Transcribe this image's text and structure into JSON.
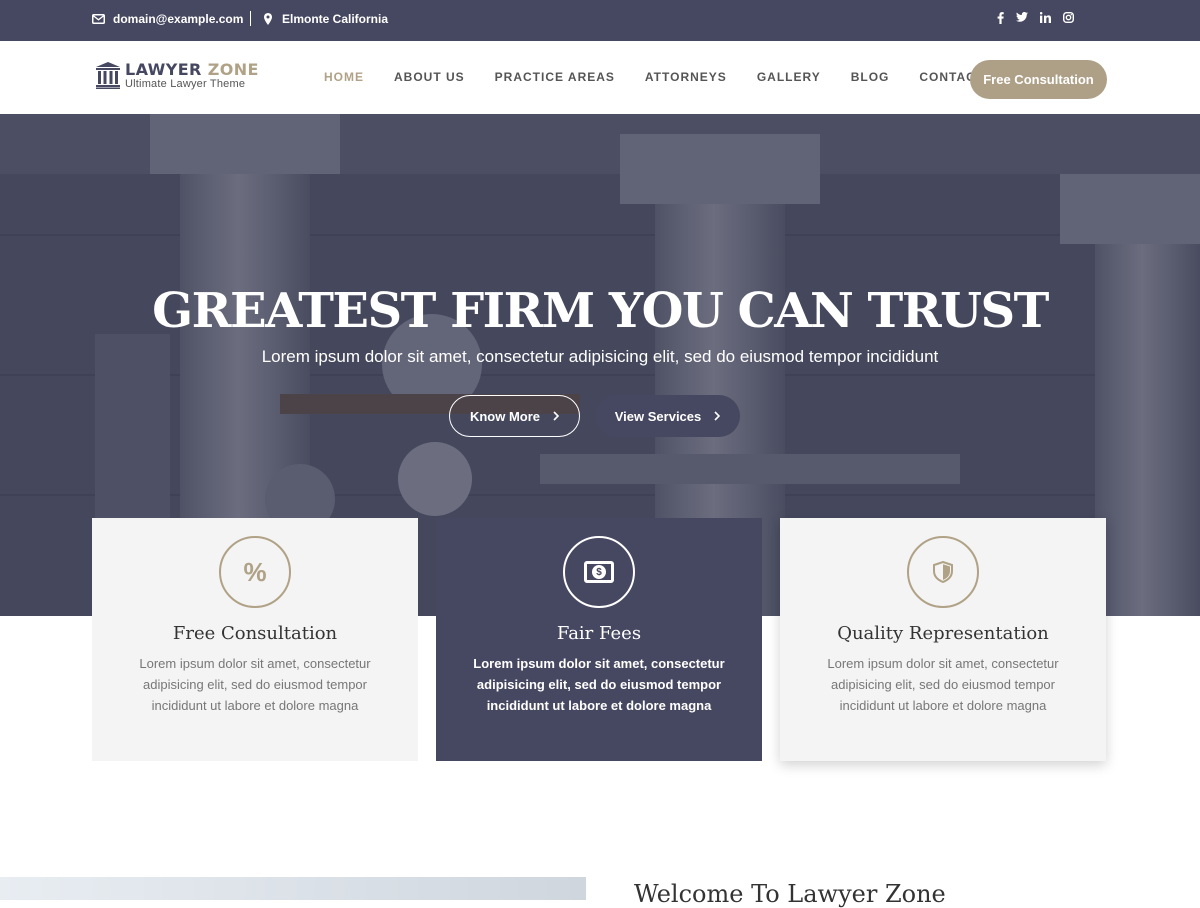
{
  "topbar": {
    "email": "domain@example.com",
    "location": "Elmonte California"
  },
  "social": {
    "facebook": "f",
    "twitter": "t",
    "linkedin": "in",
    "instagram": "ig"
  },
  "logo": {
    "title_part1": "LAWYER ",
    "title_part2": "ZONE",
    "subtitle": "Ultimate Lawyer Theme"
  },
  "nav": {
    "items": [
      "HOME",
      "ABOUT US",
      "PRACTICE AREAS",
      "ATTORNEYS",
      "GALLERY",
      "BLOG",
      "CONTACT"
    ]
  },
  "cta": {
    "label": "Free Consultation"
  },
  "hero": {
    "title": "GREATEST FIRM YOU CAN TRUST",
    "subtitle": "Lorem ipsum dolor sit amet, consectetur adipisicing elit, sed do eiusmod tempor incididunt",
    "btn_know": "Know More",
    "btn_view": "View Services"
  },
  "cards": [
    {
      "title": "Free Consultation",
      "text": "Lorem ipsum dolor sit amet, consectetur adipisicing elit, sed do eiusmod tempor incididunt ut labore et dolore magna",
      "icon_symbol": "%"
    },
    {
      "title": "Fair Fees",
      "text": "Lorem ipsum dolor sit amet, consectetur adipisicing elit, sed do eiusmod tempor incididunt ut labore et dolore magna",
      "icon_symbol": "$"
    },
    {
      "title": "Quality Representation",
      "text": "Lorem ipsum dolor sit amet, consectetur adipisicing elit, sed do eiusmod tempor incididunt ut labore et dolore magna"
    }
  ],
  "welcome": {
    "title": "Welcome To Lawyer Zone"
  },
  "colors": {
    "primary": "#464760",
    "gold": "#b0a286",
    "card_bg": "#f4f4f4"
  }
}
